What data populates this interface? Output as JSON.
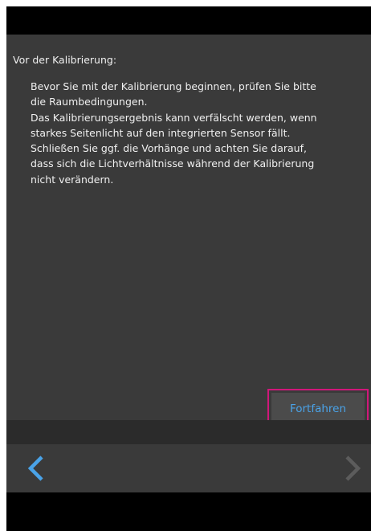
{
  "calibration_notice": {
    "heading": "Vor der Kalibrierung:",
    "lines": [
      "Bevor Sie mit der Kalibrierung beginnen, prüfen Sie bitte",
      "die Raumbedingungen.",
      "Das Kalibrierungsergebnis kann verfälscht werden, wenn",
      "starkes Seitenlicht auf den integrierten Sensor fällt.",
      "Schließen Sie ggf. die Vorhänge und achten Sie darauf,",
      "dass sich die Lichtverhältnisse während der Kalibrierung",
      "nicht verändern."
    ]
  },
  "actions": {
    "continue_label": "Fortfahren"
  },
  "navigation": {
    "back_icon": "chevron-left-icon",
    "next_icon": "chevron-right-icon",
    "back_enabled": true,
    "next_enabled": false
  },
  "colors": {
    "background": "#000000",
    "panel": "#3a3a3a",
    "text": "#f0f0f0",
    "accent": "#4aa3e8",
    "highlight": "#d0177a",
    "disabled": "#5c5c5c"
  }
}
